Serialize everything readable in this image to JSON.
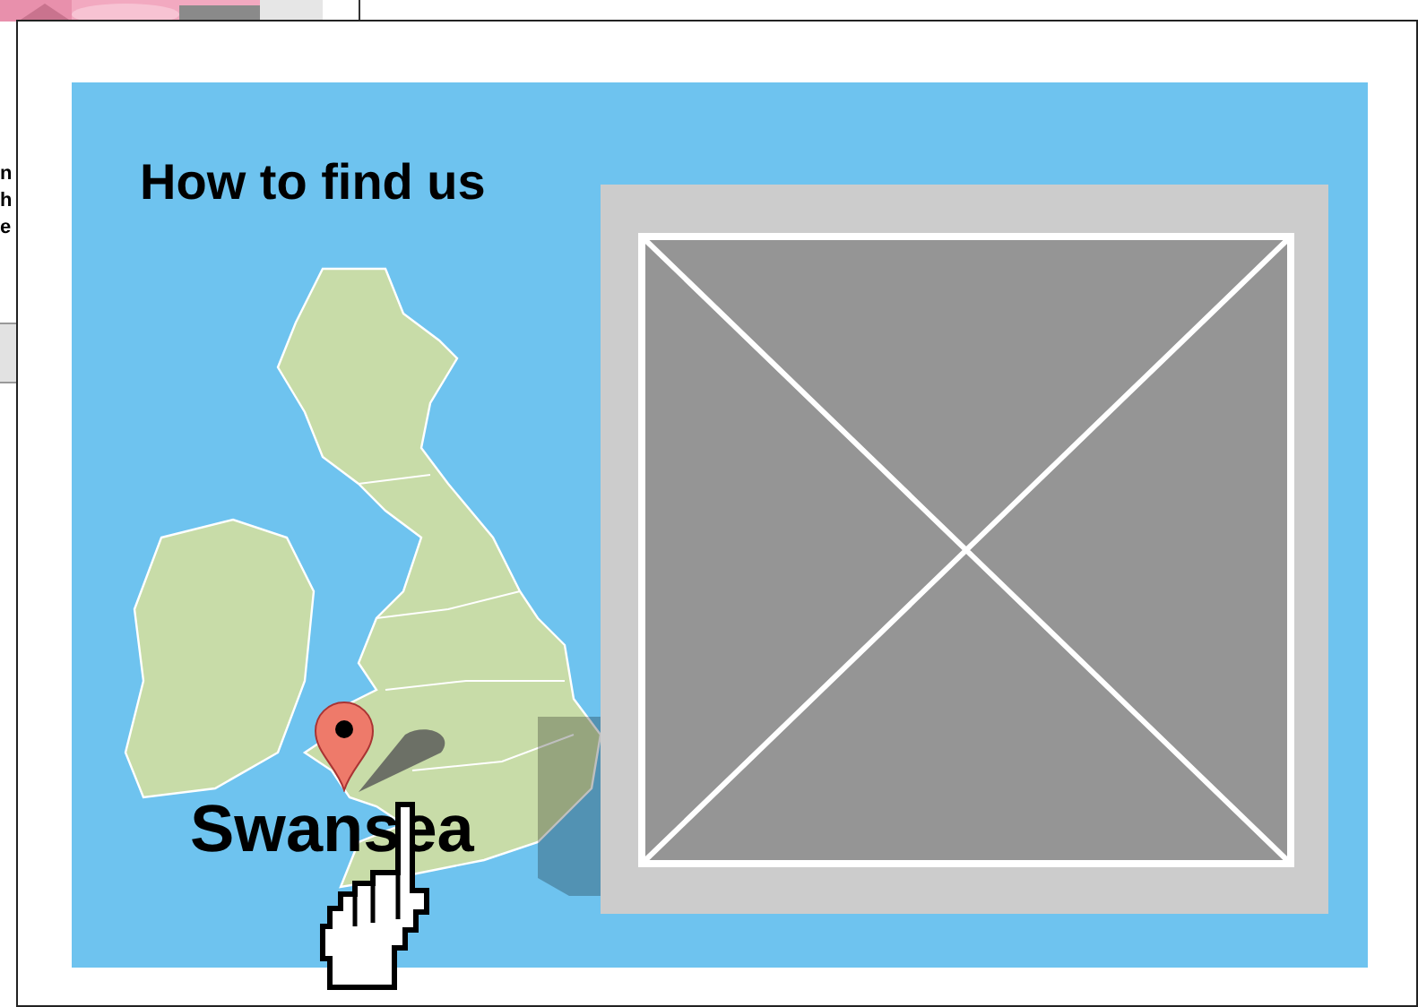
{
  "background_page": {
    "text_fragments": [
      "n",
      "h",
      "e"
    ]
  },
  "map_panel": {
    "title": "How to find us",
    "location_label": "Swansea"
  }
}
